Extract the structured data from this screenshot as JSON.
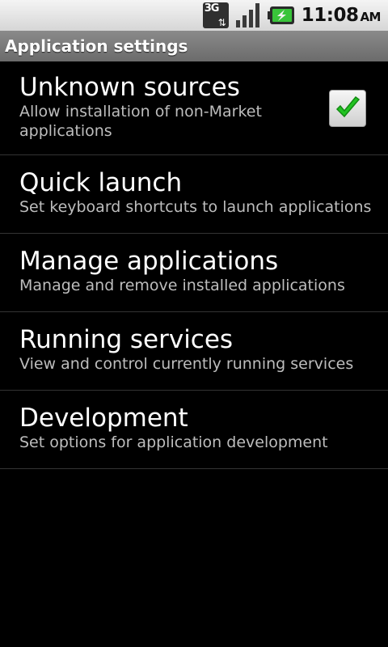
{
  "status_bar": {
    "network_label": "3G",
    "clock_time": "11:08",
    "clock_ampm": "AM",
    "icons": [
      "network-3g-icon",
      "signal-icon",
      "battery-charging-icon"
    ]
  },
  "title_bar": {
    "title": "Application settings"
  },
  "settings": [
    {
      "title": "Unknown sources",
      "summary": "Allow installation of non-Market applications",
      "checked": true
    },
    {
      "title": "Quick launch",
      "summary": "Set keyboard shortcuts to launch applications"
    },
    {
      "title": "Manage applications",
      "summary": "Manage and remove installed applications"
    },
    {
      "title": "Running services",
      "summary": "View and control currently running services"
    },
    {
      "title": "Development",
      "summary": "Set options for application development"
    }
  ],
  "colors": {
    "background": "#000000",
    "title_bar": "#7a7a7a",
    "summary_text": "#bdbdbd",
    "checkmark": "#22c322",
    "divider": "#333333"
  }
}
